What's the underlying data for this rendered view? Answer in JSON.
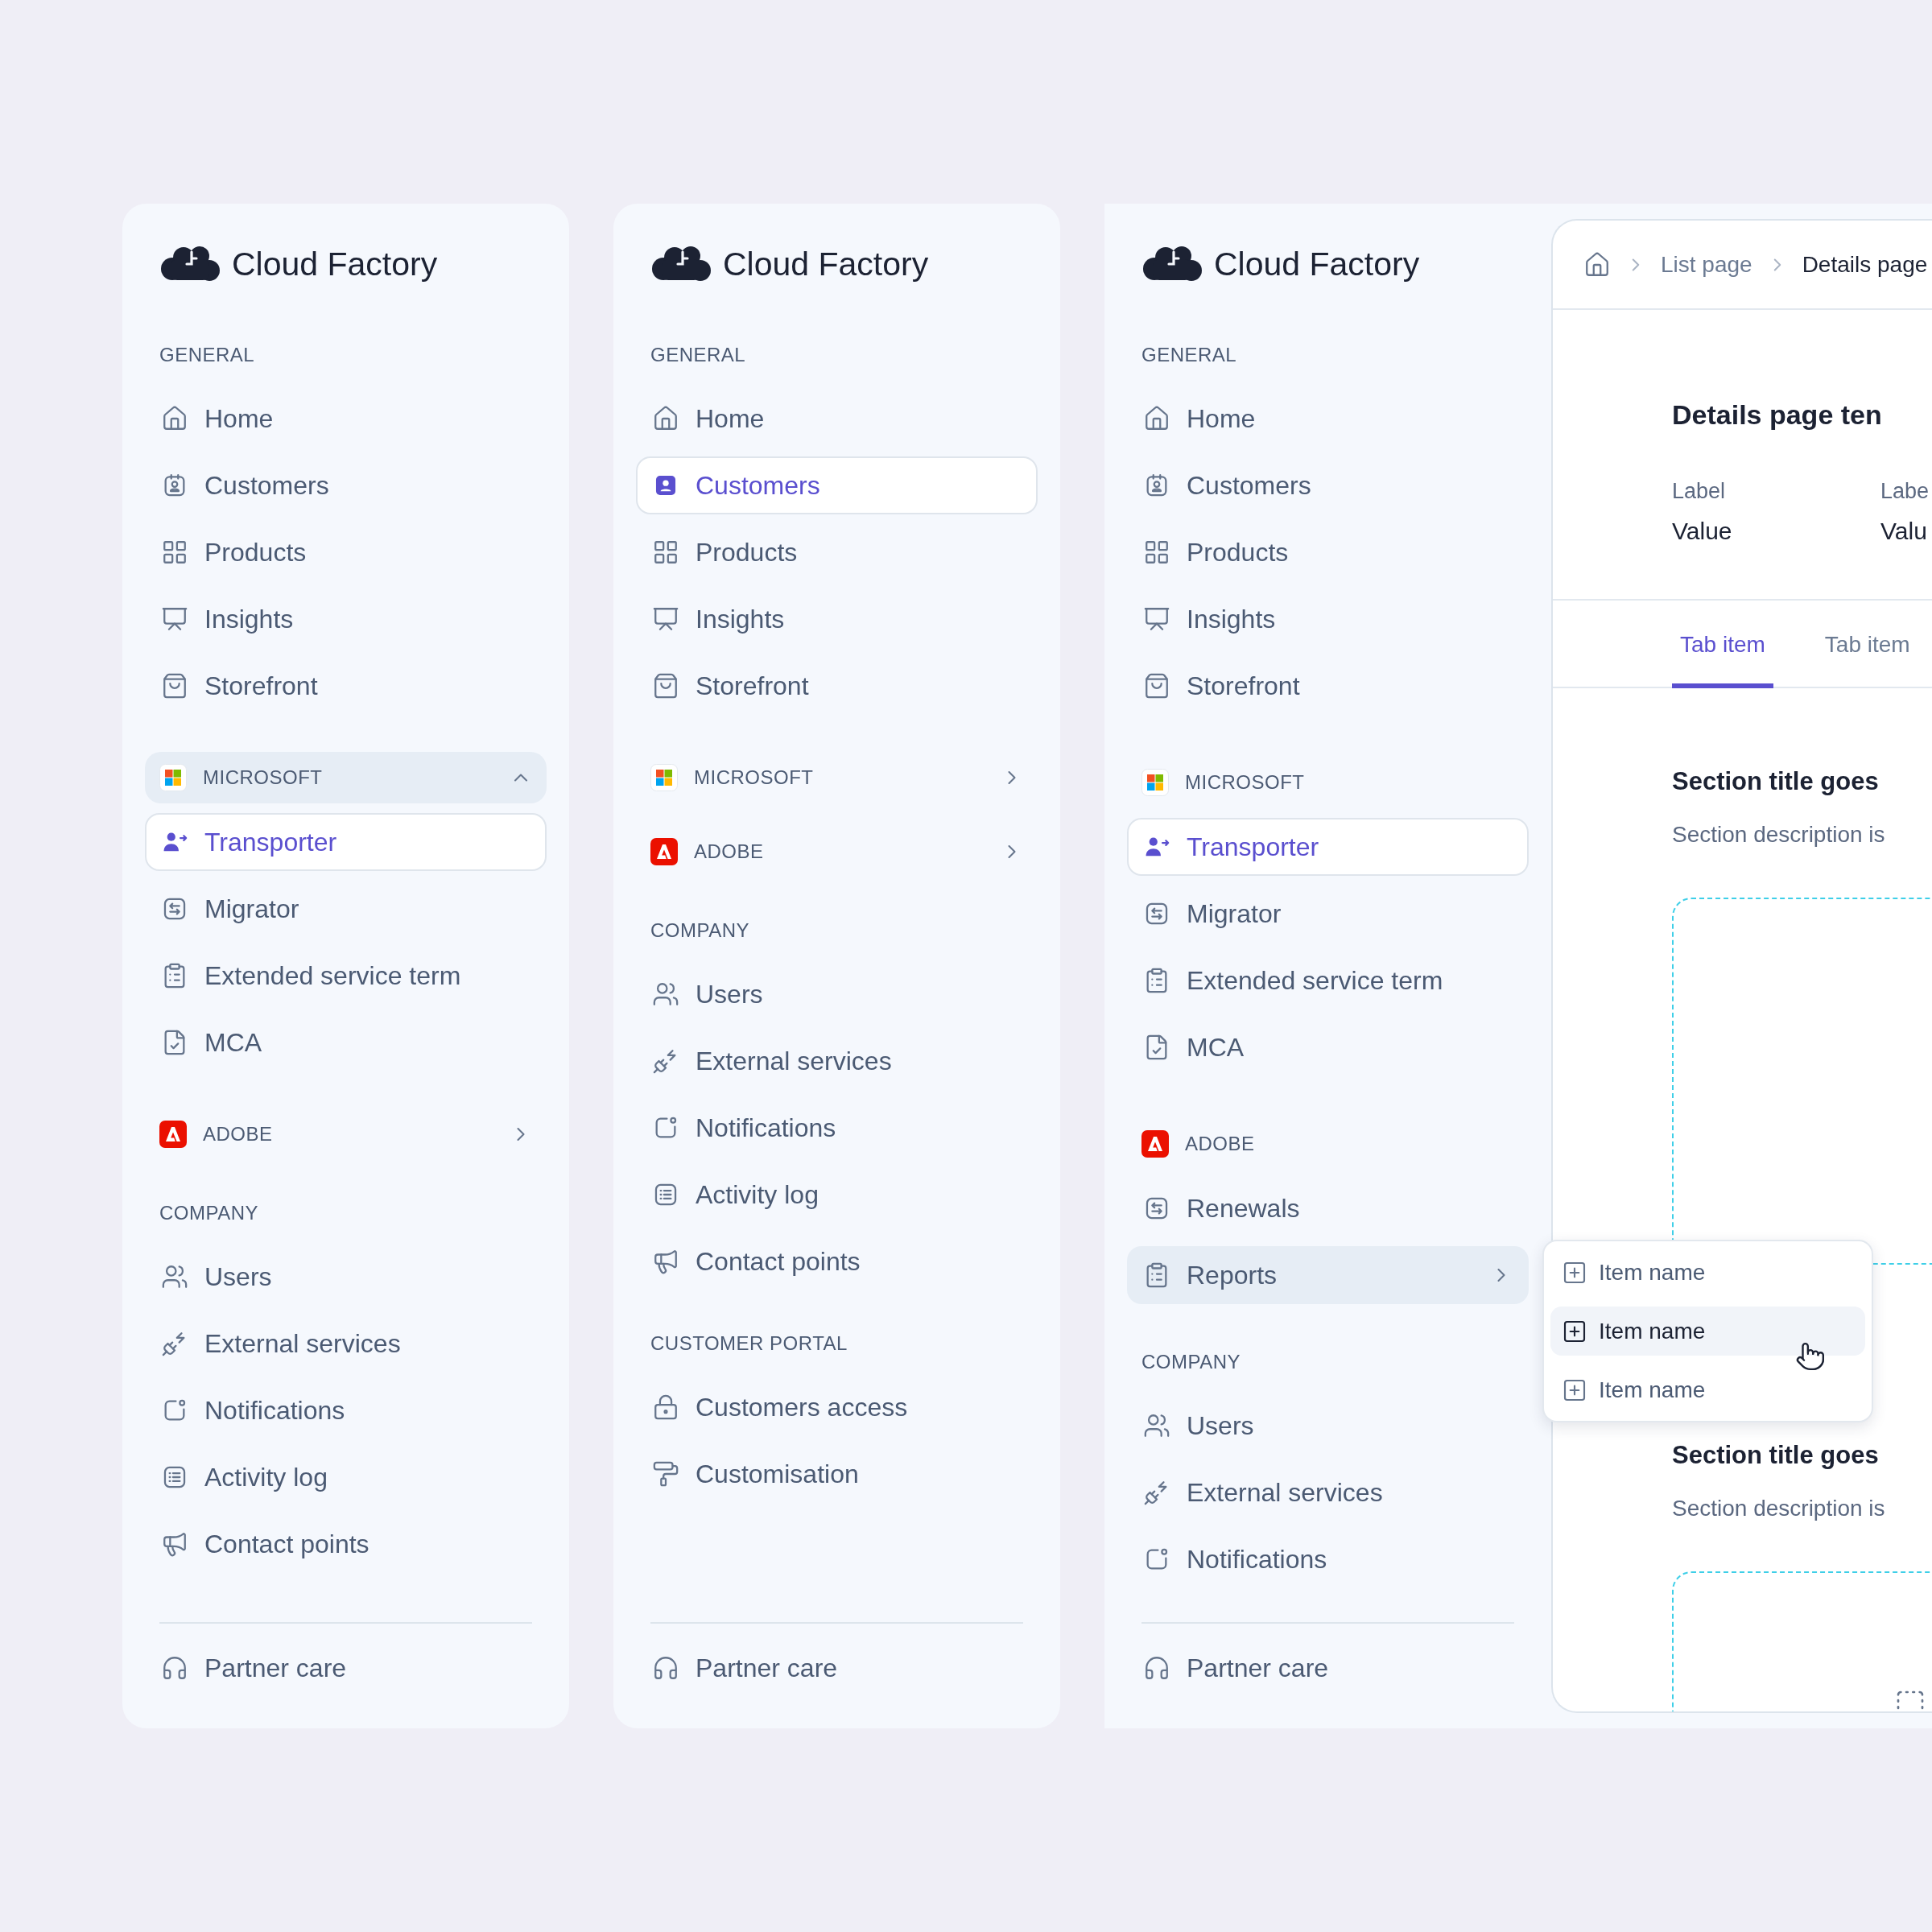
{
  "panels": [
    {
      "logo": "Cloud Factory",
      "sections": [
        {
          "kind": "plain",
          "title": "GENERAL",
          "items": [
            {
              "label": "Home",
              "selected": false,
              "highlighted": false
            },
            {
              "label": "Customers",
              "selected": false,
              "highlighted": false
            },
            {
              "label": "Products",
              "selected": false,
              "highlighted": false
            },
            {
              "label": "Insights",
              "selected": false,
              "highlighted": false
            },
            {
              "label": "Storefront",
              "selected": false,
              "highlighted": false
            }
          ]
        },
        {
          "kind": "group",
          "title": "MICROSOFT",
          "expanded": true,
          "highlighted": true,
          "items": [
            {
              "label": "Transporter",
              "selected": true,
              "highlighted": false
            },
            {
              "label": "Migrator",
              "selected": false,
              "highlighted": false
            },
            {
              "label": "Extended service term",
              "selected": false,
              "highlighted": false
            },
            {
              "label": "MCA",
              "selected": false,
              "highlighted": false
            }
          ]
        },
        {
          "kind": "group",
          "title": "ADOBE",
          "expanded": false,
          "highlighted": false
        },
        {
          "kind": "plain",
          "title": "COMPANY",
          "items": [
            {
              "label": "Users",
              "selected": false,
              "highlighted": false
            },
            {
              "label": "External services",
              "selected": false,
              "highlighted": false
            },
            {
              "label": "Notifications",
              "selected": false,
              "highlighted": false
            },
            {
              "label": "Activity log",
              "selected": false,
              "highlighted": false
            },
            {
              "label": "Contact points",
              "selected": false,
              "highlighted": false
            }
          ]
        }
      ],
      "footer": {
        "label": "Partner care"
      }
    },
    {
      "logo": "Cloud Factory",
      "sections": [
        {
          "kind": "plain",
          "title": "GENERAL",
          "items": [
            {
              "label": "Home",
              "selected": false,
              "highlighted": false
            },
            {
              "label": "Customers",
              "selected": true,
              "highlighted": false
            },
            {
              "label": "Products",
              "selected": false,
              "highlighted": false
            },
            {
              "label": "Insights",
              "selected": false,
              "highlighted": false
            },
            {
              "label": "Storefront",
              "selected": false,
              "highlighted": false
            }
          ]
        },
        {
          "kind": "group",
          "title": "MICROSOFT",
          "expanded": false,
          "highlighted": false
        },
        {
          "kind": "group",
          "title": "ADOBE",
          "expanded": false,
          "highlighted": false
        },
        {
          "kind": "plain",
          "title": "COMPANY",
          "items": [
            {
              "label": "Users",
              "selected": false,
              "highlighted": false
            },
            {
              "label": "External services",
              "selected": false,
              "highlighted": false
            },
            {
              "label": "Notifications",
              "selected": false,
              "highlighted": false
            },
            {
              "label": "Activity log",
              "selected": false,
              "highlighted": false
            },
            {
              "label": "Contact points",
              "selected": false,
              "highlighted": false
            }
          ]
        },
        {
          "kind": "plain",
          "title": "CUSTOMER PORTAL",
          "items": [
            {
              "label": "Customers access",
              "selected": false,
              "highlighted": false
            },
            {
              "label": "Customisation",
              "selected": false,
              "highlighted": false
            }
          ]
        }
      ],
      "footer": {
        "label": "Partner care"
      }
    },
    {
      "logo": "Cloud Factory",
      "sections": [
        {
          "kind": "plain",
          "title": "GENERAL",
          "items": [
            {
              "label": "Home",
              "selected": false,
              "highlighted": false
            },
            {
              "label": "Customers",
              "selected": false,
              "highlighted": false
            },
            {
              "label": "Products",
              "selected": false,
              "highlighted": false
            },
            {
              "label": "Insights",
              "selected": false,
              "highlighted": false
            },
            {
              "label": "Storefront",
              "selected": false,
              "highlighted": false
            }
          ]
        },
        {
          "kind": "brand",
          "title": "MICROSOFT",
          "items": [
            {
              "label": "Transporter",
              "selected": true,
              "highlighted": false
            },
            {
              "label": "Migrator",
              "selected": false,
              "highlighted": false
            },
            {
              "label": "Extended service term",
              "selected": false,
              "highlighted": false
            },
            {
              "label": "MCA",
              "selected": false,
              "highlighted": false
            }
          ]
        },
        {
          "kind": "brand",
          "title": "ADOBE",
          "items": [
            {
              "label": "Renewals",
              "selected": false,
              "highlighted": false
            },
            {
              "label": "Reports",
              "selected": false,
              "highlighted": true
            }
          ]
        },
        {
          "kind": "plain",
          "title": "COMPANY",
          "items": [
            {
              "label": "Users",
              "selected": false,
              "highlighted": false
            },
            {
              "label": "External services",
              "selected": false,
              "highlighted": false
            },
            {
              "label": "Notifications",
              "selected": false,
              "highlighted": false
            }
          ]
        }
      ],
      "footer": {
        "label": "Partner care"
      }
    }
  ],
  "dropdown": {
    "items": [
      {
        "label": "Item name",
        "highlighted": false
      },
      {
        "label": "Item name",
        "highlighted": true
      },
      {
        "label": "Item name",
        "highlighted": false
      }
    ]
  },
  "details": {
    "breadcrumb": [
      {
        "label": "List page",
        "current": false
      },
      {
        "label": "Details page",
        "current": true
      }
    ],
    "title": "Details page ten",
    "fields": [
      {
        "label": "Label",
        "value": "Value"
      },
      {
        "label": "Labe",
        "value": "Valu"
      }
    ],
    "tabs": [
      {
        "label": "Tab item",
        "selected": true
      },
      {
        "label": "Tab item",
        "selected": false
      }
    ],
    "sections": [
      {
        "title": "Section title goes",
        "description": "Section description is"
      },
      {
        "title": "Section title goes",
        "description": "Section description is"
      }
    ]
  }
}
